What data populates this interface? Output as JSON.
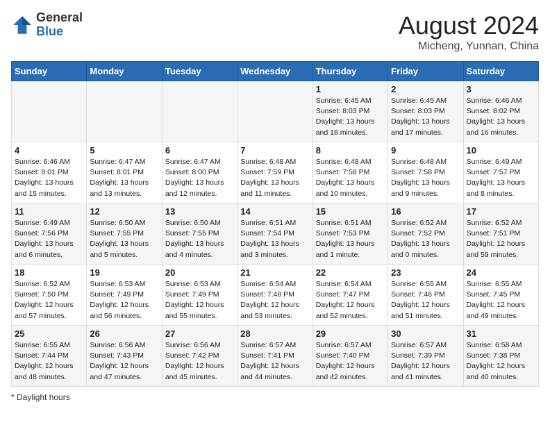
{
  "header": {
    "logo_general": "General",
    "logo_blue": "Blue",
    "month_title": "August 2024",
    "location": "Micheng, Yunnan, China"
  },
  "weekdays": [
    "Sunday",
    "Monday",
    "Tuesday",
    "Wednesday",
    "Thursday",
    "Friday",
    "Saturday"
  ],
  "footer": {
    "daylight_label": "Daylight hours"
  },
  "weeks": [
    [
      {
        "day": "",
        "info": ""
      },
      {
        "day": "",
        "info": ""
      },
      {
        "day": "",
        "info": ""
      },
      {
        "day": "",
        "info": ""
      },
      {
        "day": "1",
        "info": "Sunrise: 6:45 AM\nSunset: 8:03 PM\nDaylight: 13 hours and 18 minutes."
      },
      {
        "day": "2",
        "info": "Sunrise: 6:45 AM\nSunset: 8:03 PM\nDaylight: 13 hours and 17 minutes."
      },
      {
        "day": "3",
        "info": "Sunrise: 6:46 AM\nSunset: 8:02 PM\nDaylight: 13 hours and 16 minutes."
      }
    ],
    [
      {
        "day": "4",
        "info": "Sunrise: 6:46 AM\nSunset: 8:01 PM\nDaylight: 13 hours and 15 minutes."
      },
      {
        "day": "5",
        "info": "Sunrise: 6:47 AM\nSunset: 8:01 PM\nDaylight: 13 hours and 13 minutes."
      },
      {
        "day": "6",
        "info": "Sunrise: 6:47 AM\nSunset: 8:00 PM\nDaylight: 13 hours and 12 minutes."
      },
      {
        "day": "7",
        "info": "Sunrise: 6:48 AM\nSunset: 7:59 PM\nDaylight: 13 hours and 11 minutes."
      },
      {
        "day": "8",
        "info": "Sunrise: 6:48 AM\nSunset: 7:58 PM\nDaylight: 13 hours and 10 minutes."
      },
      {
        "day": "9",
        "info": "Sunrise: 6:48 AM\nSunset: 7:58 PM\nDaylight: 13 hours and 9 minutes."
      },
      {
        "day": "10",
        "info": "Sunrise: 6:49 AM\nSunset: 7:57 PM\nDaylight: 13 hours and 8 minutes."
      }
    ],
    [
      {
        "day": "11",
        "info": "Sunrise: 6:49 AM\nSunset: 7:56 PM\nDaylight: 13 hours and 6 minutes."
      },
      {
        "day": "12",
        "info": "Sunrise: 6:50 AM\nSunset: 7:55 PM\nDaylight: 13 hours and 5 minutes."
      },
      {
        "day": "13",
        "info": "Sunrise: 6:50 AM\nSunset: 7:55 PM\nDaylight: 13 hours and 4 minutes."
      },
      {
        "day": "14",
        "info": "Sunrise: 6:51 AM\nSunset: 7:54 PM\nDaylight: 13 hours and 3 minutes."
      },
      {
        "day": "15",
        "info": "Sunrise: 6:51 AM\nSunset: 7:53 PM\nDaylight: 13 hours and 1 minute."
      },
      {
        "day": "16",
        "info": "Sunrise: 6:52 AM\nSunset: 7:52 PM\nDaylight: 13 hours and 0 minutes."
      },
      {
        "day": "17",
        "info": "Sunrise: 6:52 AM\nSunset: 7:51 PM\nDaylight: 12 hours and 59 minutes."
      }
    ],
    [
      {
        "day": "18",
        "info": "Sunrise: 6:52 AM\nSunset: 7:50 PM\nDaylight: 12 hours and 57 minutes."
      },
      {
        "day": "19",
        "info": "Sunrise: 6:53 AM\nSunset: 7:49 PM\nDaylight: 12 hours and 56 minutes."
      },
      {
        "day": "20",
        "info": "Sunrise: 6:53 AM\nSunset: 7:49 PM\nDaylight: 12 hours and 55 minutes."
      },
      {
        "day": "21",
        "info": "Sunrise: 6:54 AM\nSunset: 7:48 PM\nDaylight: 12 hours and 53 minutes."
      },
      {
        "day": "22",
        "info": "Sunrise: 6:54 AM\nSunset: 7:47 PM\nDaylight: 12 hours and 52 minutes."
      },
      {
        "day": "23",
        "info": "Sunrise: 6:55 AM\nSunset: 7:46 PM\nDaylight: 12 hours and 51 minutes."
      },
      {
        "day": "24",
        "info": "Sunrise: 6:55 AM\nSunset: 7:45 PM\nDaylight: 12 hours and 49 minutes."
      }
    ],
    [
      {
        "day": "25",
        "info": "Sunrise: 6:55 AM\nSunset: 7:44 PM\nDaylight: 12 hours and 48 minutes."
      },
      {
        "day": "26",
        "info": "Sunrise: 6:56 AM\nSunset: 7:43 PM\nDaylight: 12 hours and 47 minutes."
      },
      {
        "day": "27",
        "info": "Sunrise: 6:56 AM\nSunset: 7:42 PM\nDaylight: 12 hours and 45 minutes."
      },
      {
        "day": "28",
        "info": "Sunrise: 6:57 AM\nSunset: 7:41 PM\nDaylight: 12 hours and 44 minutes."
      },
      {
        "day": "29",
        "info": "Sunrise: 6:57 AM\nSunset: 7:40 PM\nDaylight: 12 hours and 42 minutes."
      },
      {
        "day": "30",
        "info": "Sunrise: 6:57 AM\nSunset: 7:39 PM\nDaylight: 12 hours and 41 minutes."
      },
      {
        "day": "31",
        "info": "Sunrise: 6:58 AM\nSunset: 7:38 PM\nDaylight: 12 hours and 40 minutes."
      }
    ]
  ]
}
